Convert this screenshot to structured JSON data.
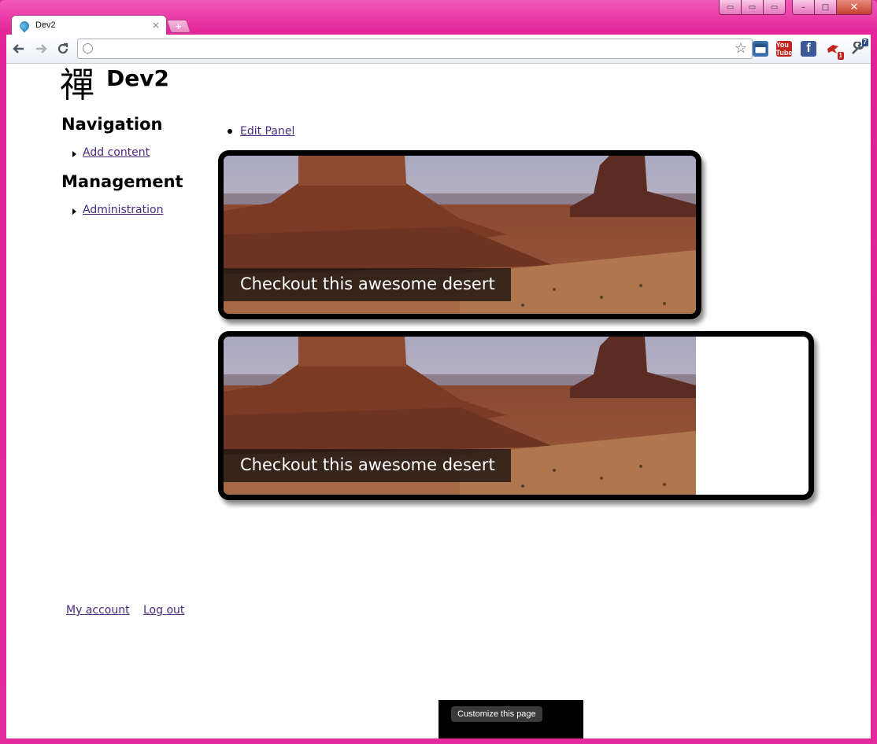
{
  "browser": {
    "tab_title": "Dev2",
    "tab_close": "×",
    "new_tab": "+",
    "address": "",
    "window_buttons": {
      "minimize": "–",
      "maximize": "□",
      "close": "✕"
    },
    "extensions": [
      {
        "name": "window-icon",
        "color": "#3a6fb0"
      },
      {
        "name": "youtube-icon",
        "label": "You Tube",
        "color": "#c4221c"
      },
      {
        "name": "facebook-icon",
        "label": "f",
        "color": "#3b5998"
      },
      {
        "name": "extension-bird-icon",
        "badge": "1",
        "color": "#c4221c"
      },
      {
        "name": "wrench-icon",
        "badge": "7",
        "color": "#4a5563"
      }
    ]
  },
  "site": {
    "logo": "禪",
    "name": "Dev2"
  },
  "sidebar": {
    "navigation_title": "Navigation",
    "navigation_items": [
      "Add content"
    ],
    "management_title": "Management",
    "management_items": [
      "Administration"
    ]
  },
  "content": {
    "edit_panel": "Edit Panel",
    "panels": [
      {
        "caption": "Checkout this awesome desert"
      },
      {
        "caption": "Checkout this awesome desert"
      }
    ]
  },
  "footer": {
    "my_account": "My account",
    "log_out": "Log out"
  },
  "customize": {
    "button": "Customize this page"
  }
}
